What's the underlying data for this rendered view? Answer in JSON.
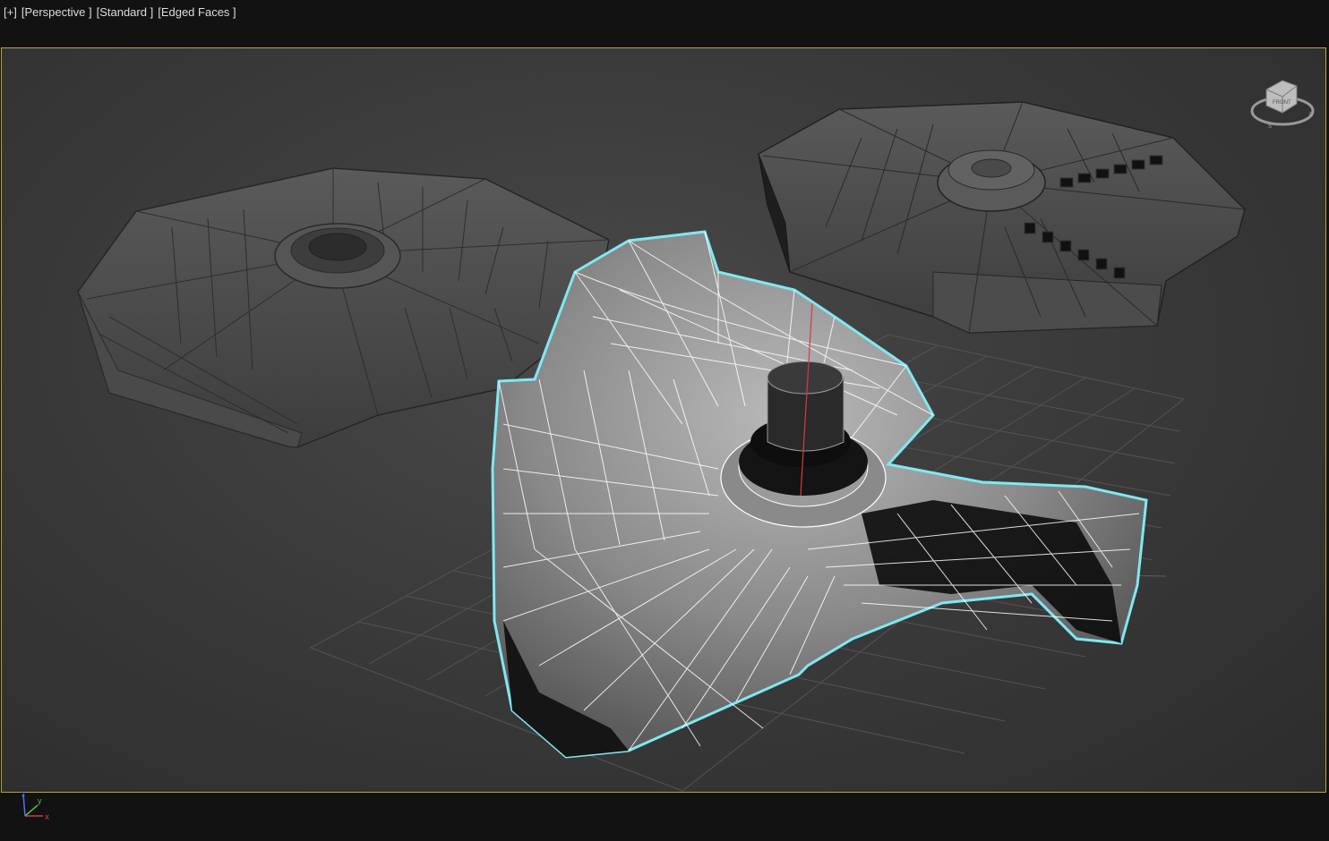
{
  "viewport": {
    "label": {
      "menu": "[+]",
      "view": "[Perspective ]",
      "shading": "[Standard ]",
      "display": "[Edged Faces ]"
    },
    "viewcube": {
      "face_label": "FRONT",
      "compass_icon": "compass-ring-icon"
    },
    "axis_tripod": {
      "x": "x",
      "y": "y",
      "z": "z"
    }
  },
  "colors": {
    "viewport_border": "#b9a43c",
    "selection_outline": "#7fe8f2",
    "wireframe_selected": "#ffffff",
    "mesh_gray": "#6e6e6e",
    "axis_x": "#d83a3a",
    "axis_y": "#4cc04c",
    "axis_z": "#5a6cff"
  }
}
